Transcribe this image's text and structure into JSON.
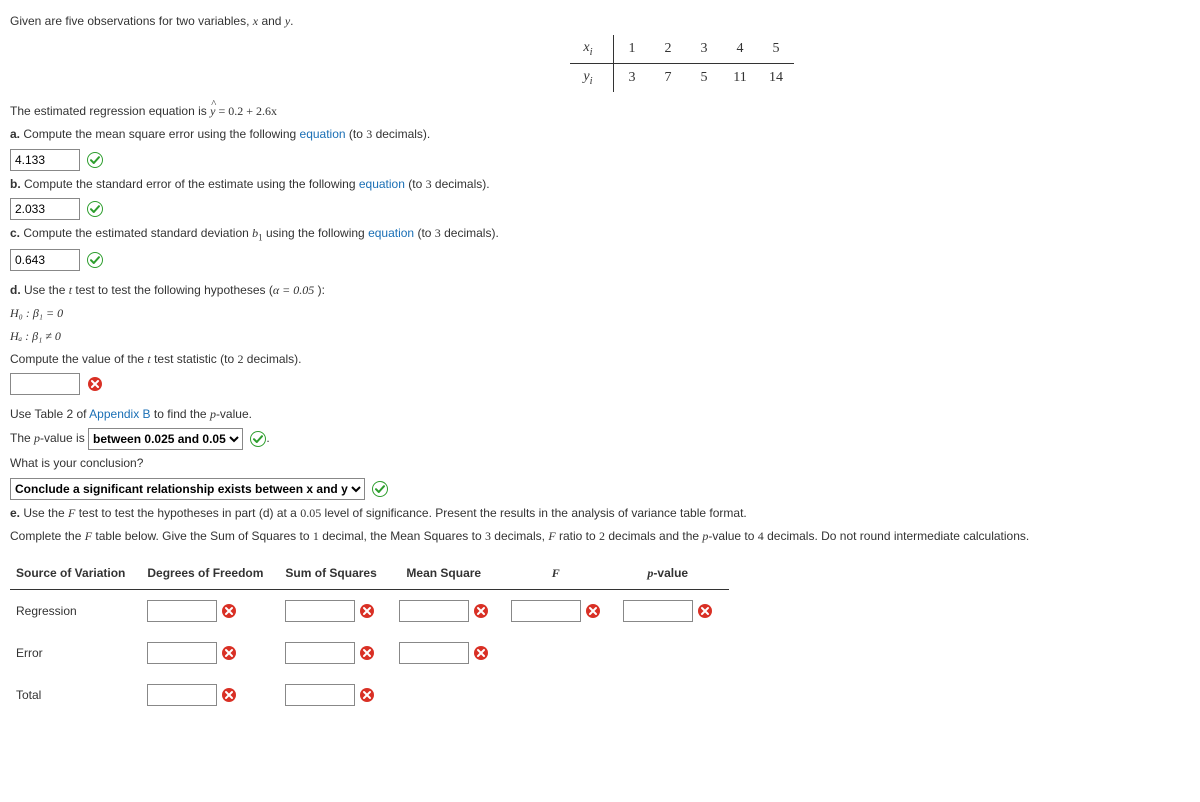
{
  "intro": "Given are five observations for two variables, ",
  "intro2": " and ",
  "table": {
    "xlabel": "x",
    "ylabel": "y",
    "x": [
      "1",
      "2",
      "3",
      "4",
      "5"
    ],
    "y": [
      "3",
      "7",
      "5",
      "11",
      "14"
    ]
  },
  "reg": {
    "pre": "The estimated regression equation is ",
    "eq_lhs": "ŷ",
    "eq_rhs": " = 0.2 + 2.6x"
  },
  "a": {
    "label": "a.",
    "text1": " Compute the mean square error using the following ",
    "link": "equation",
    "text2": " (to ",
    "prec": "3",
    "text3": " decimals).",
    "value": "4.133"
  },
  "b": {
    "label": "b.",
    "text1": " Compute the standard error of the estimate using the following ",
    "link": "equation",
    "text2": " (to ",
    "prec": "3",
    "text3": " decimals).",
    "value": "2.033"
  },
  "c": {
    "label": "c.",
    "text1": " Compute the estimated standard deviation ",
    "sym": "b",
    "sub": "1",
    "text2": " using the following ",
    "link": "equation",
    "text3": " (to ",
    "prec": "3",
    "text4": " decimals).",
    "value": "0.643"
  },
  "d": {
    "label": "d.",
    "text1": " Use the ",
    "tsym": "t",
    "text2": " test to test the following hypotheses (",
    "alpha": "α = 0.05",
    "text3": " ):",
    "h0": "H₀ : β₁ = 0",
    "ha": "Hₐ : β₁ ≠ 0",
    "compute": "Compute the value of the ",
    "compute2": " test statistic (to ",
    "prec": "2",
    "compute3": " decimals).",
    "t_value": "",
    "use_table_pre": "Use Table 2 of ",
    "appendix": "Appendix B",
    "use_table_post": " to find the ",
    "psym": "p",
    "use_table_post2": "-value.",
    "pline_pre": "The ",
    "pline_post": "-value is",
    "p_select": "between 0.025 and 0.05",
    "concl_q": "What is your conclusion?",
    "concl_select": "Conclude a significant relationship exists between x and y"
  },
  "e": {
    "label": "e.",
    "text1": " Use the ",
    "Fsym": "F",
    "text2": " test to test the hypotheses in part (d) at a ",
    "alpha": "0.05",
    "text3": " level of significance. Present the results in the analysis of variance table format.",
    "instr_pre": "Complete the ",
    "instr_post": " table below. Give the Sum of Squares to ",
    "ss_prec": "1",
    "instr2": " decimal, the Mean Squares to ",
    "ms_prec": "3",
    "instr3": " decimals, ",
    "instr4": " ratio to ",
    "f_prec": "2",
    "instr5": " decimals and the ",
    "psym": "p",
    "instr6": "-value to ",
    "p_prec": "4",
    "instr7": " decimals. Do not round intermediate calculations."
  },
  "anova": {
    "h1": "Source of Variation",
    "h2": "Degrees of Freedom",
    "h3": "Sum of Squares",
    "h4": "Mean Square",
    "h5": "F",
    "h6": "p-value",
    "r1": "Regression",
    "r2": "Error",
    "r3": "Total"
  }
}
